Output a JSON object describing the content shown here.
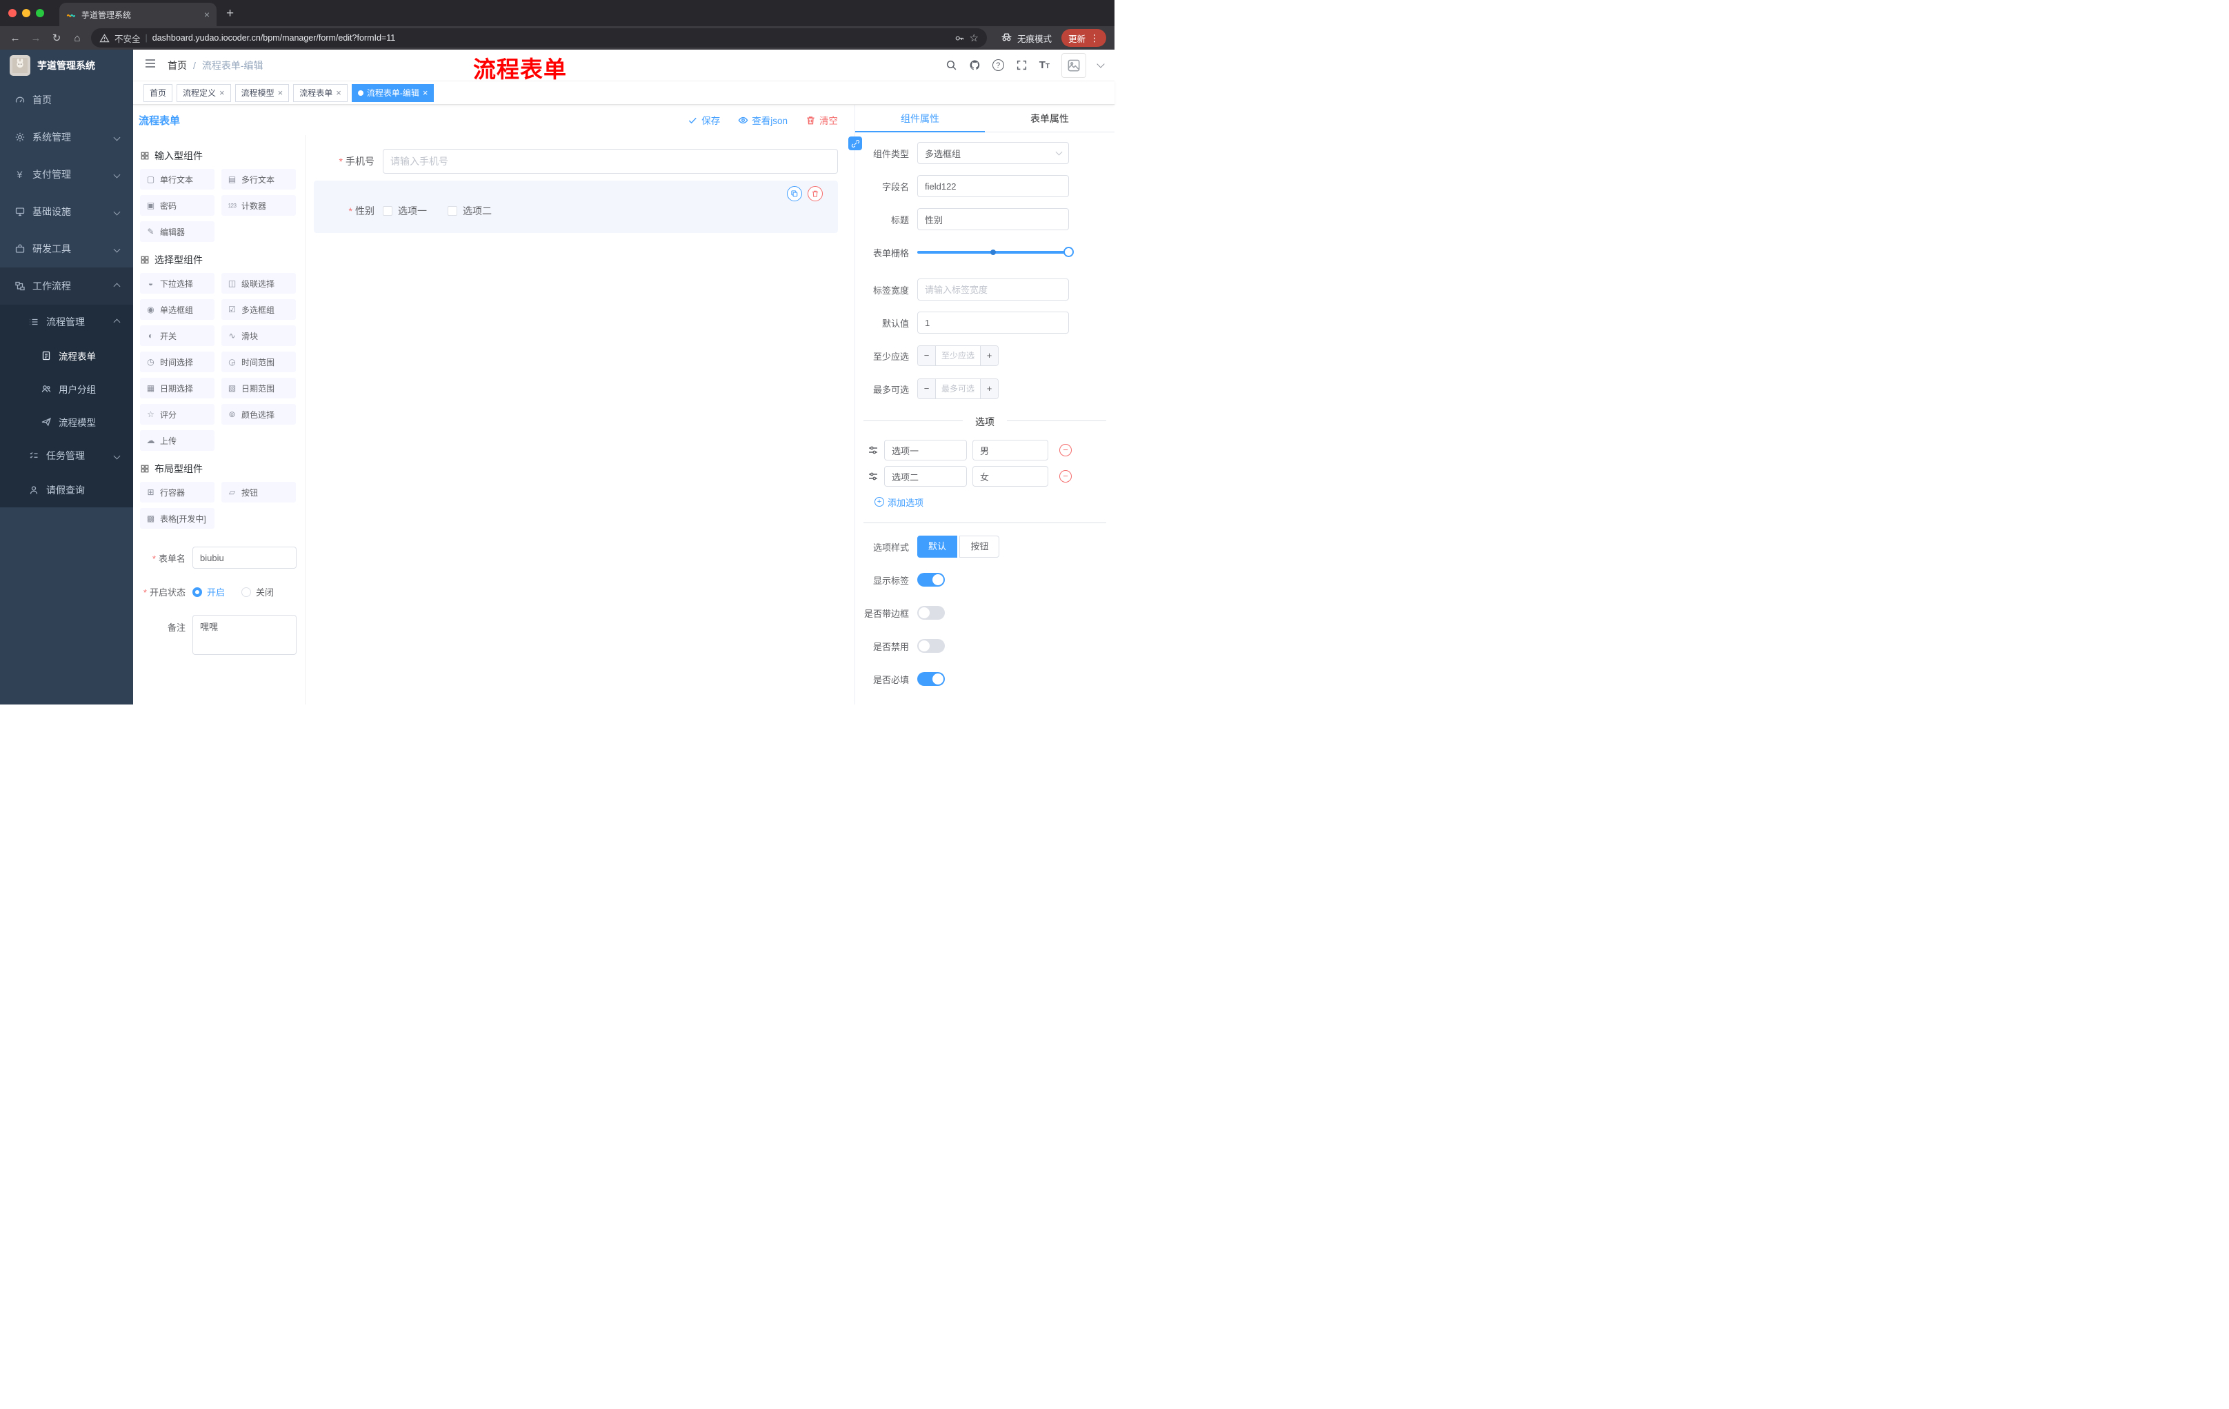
{
  "icons": {
    "back": "←",
    "forward": "→",
    "reload": "↻",
    "home": "⌂",
    "star": "☆",
    "plus_tab": "+",
    "close_tab": "×",
    "minus": "−",
    "plus": "+",
    "more": "⋮"
  },
  "browser": {
    "tab_title": "芋道管理系统",
    "security_label": "不安全",
    "url": "dashboard.yudao.iocoder.cn/bpm/manager/form/edit?formId=11",
    "incognito_label": "无痕模式",
    "update_label": "更新"
  },
  "annotation": {
    "text": "流程表单",
    "color": "#ff0000"
  },
  "app_header": {
    "breadcrumb_home": "首页",
    "breadcrumb_current": "流程表单-编辑"
  },
  "sidebar": {
    "logo_title": "芋道管理系统",
    "items": [
      {
        "label": "首页"
      },
      {
        "label": "系统管理"
      },
      {
        "label": "支付管理"
      },
      {
        "label": "基础设施"
      },
      {
        "label": "研发工具"
      },
      {
        "label": "工作流程"
      }
    ],
    "sub": {
      "process_mgmt": "流程管理",
      "process_form": "流程表单",
      "user_group": "用户分组",
      "process_model": "流程模型",
      "task_mgmt": "任务管理",
      "leave_query": "请假查询"
    }
  },
  "tags": [
    {
      "label": "首页",
      "closable": false,
      "active": false
    },
    {
      "label": "流程定义",
      "closable": true,
      "active": false
    },
    {
      "label": "流程模型",
      "closable": true,
      "active": false
    },
    {
      "label": "流程表单",
      "closable": true,
      "active": false
    },
    {
      "label": "流程表单-编辑",
      "closable": true,
      "active": true
    }
  ],
  "designer": {
    "title": "流程表单",
    "save": "保存",
    "view_json": "查看json",
    "clear": "清空"
  },
  "palette": {
    "groups": [
      {
        "title": "输入型组件",
        "items": [
          {
            "label": "单行文本",
            "icon": "▢"
          },
          {
            "label": "多行文本",
            "icon": "▤"
          },
          {
            "label": "密码",
            "icon": "▣"
          },
          {
            "label": "计数器",
            "icon": "123"
          },
          {
            "label": "编辑器",
            "icon": "✎"
          }
        ]
      },
      {
        "title": "选择型组件",
        "items": [
          {
            "label": "下拉选择",
            "icon": "◒"
          },
          {
            "label": "级联选择",
            "icon": "◫"
          },
          {
            "label": "单选框组",
            "icon": "◉"
          },
          {
            "label": "多选框组",
            "icon": "☑"
          },
          {
            "label": "开关",
            "icon": "◐"
          },
          {
            "label": "滑块",
            "icon": "∿"
          },
          {
            "label": "时间选择",
            "icon": "◷"
          },
          {
            "label": "时间范围",
            "icon": "◶"
          },
          {
            "label": "日期选择",
            "icon": "▦"
          },
          {
            "label": "日期范围",
            "icon": "▧"
          },
          {
            "label": "评分",
            "icon": "☆"
          },
          {
            "label": "颜色选择",
            "icon": "⊚"
          },
          {
            "label": "上传",
            "icon": "☁"
          }
        ]
      },
      {
        "title": "布局型组件",
        "items": [
          {
            "label": "行容器",
            "icon": "⊞"
          },
          {
            "label": "按钮",
            "icon": "▱"
          },
          {
            "label": "表格[开发中]",
            "icon": "▩"
          }
        ]
      }
    ]
  },
  "meta": {
    "form_name_label": "表单名",
    "form_name_value": "biubiu",
    "status_label": "开启状态",
    "status_on": "开启",
    "status_off": "关闭",
    "status_selected": "开启",
    "remark_label": "备注",
    "remark_value": "嘿嘿"
  },
  "canvas": {
    "phone_label": "手机号",
    "phone_placeholder": "请输入手机号",
    "gender_label": "性别",
    "gender_opt1": "选项一",
    "gender_opt2": "选项二"
  },
  "props": {
    "tab_component": "组件属性",
    "tab_form": "表单属性",
    "type_label": "组件类型",
    "type_value": "多选框组",
    "field_label": "字段名",
    "field_value": "field122",
    "title_label": "标题",
    "title_value": "性别",
    "grid_label": "表单栅格",
    "width_label": "标签宽度",
    "width_placeholder": "请输入标签宽度",
    "default_label": "默认值",
    "default_value": "1",
    "min_label": "至少应选",
    "min_placeholder": "至少应选",
    "max_label": "最多可选",
    "max_placeholder": "最多可选",
    "options_title": "选项",
    "options": [
      {
        "label": "选项一",
        "value": "男"
      },
      {
        "label": "选项二",
        "value": "女"
      }
    ],
    "add_option": "添加选项",
    "style_label": "选项样式",
    "style_default": "默认",
    "style_button": "按钮",
    "style_selected": "默认",
    "toggles": [
      {
        "label": "显示标签",
        "on": true
      },
      {
        "label": "是否带边框",
        "on": false
      },
      {
        "label": "是否禁用",
        "on": false
      },
      {
        "label": "是否必填",
        "on": true
      }
    ],
    "accent_color": "#409eff"
  }
}
